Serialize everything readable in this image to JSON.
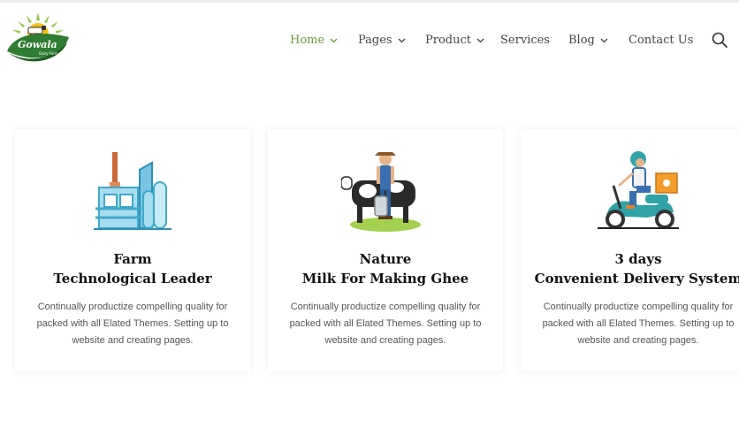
{
  "brand": {
    "name": "Gowala",
    "tagline": "Dairy Farm"
  },
  "nav": {
    "items": [
      {
        "label": "Home",
        "has_dropdown": true,
        "active": true
      },
      {
        "label": "Pages",
        "has_dropdown": true,
        "active": false
      },
      {
        "label": "Product",
        "has_dropdown": true,
        "active": false
      },
      {
        "label": "Services",
        "has_dropdown": false,
        "active": false
      },
      {
        "label": "Blog",
        "has_dropdown": true,
        "active": false
      },
      {
        "label": "Contact Us",
        "has_dropdown": false,
        "active": false
      }
    ],
    "search_icon": "search-icon"
  },
  "features": [
    {
      "icon": "factory-icon",
      "title_line1": "Farm",
      "title_line2": "Technological Leader",
      "description": "Continually productize compelling quality for packed with all Elated Themes. Setting up to website and creating pages."
    },
    {
      "icon": "farmer-cow-icon",
      "title_line1": "Nature",
      "title_line2": "Milk For Making Ghee",
      "description": "Continually productize compelling quality for packed with all Elated Themes. Setting up to website and creating pages."
    },
    {
      "icon": "delivery-scooter-icon",
      "title_line1": "3 days",
      "title_line2": "Convenient Delivery System",
      "description": "Continually productize compelling quality for packed with all Elated Themes. Setting up to website and creating pages."
    }
  ],
  "colors": {
    "accent_green": "#6a9c3a",
    "text_dark": "#111111",
    "text_body": "#555555",
    "nav_text": "#444444"
  }
}
